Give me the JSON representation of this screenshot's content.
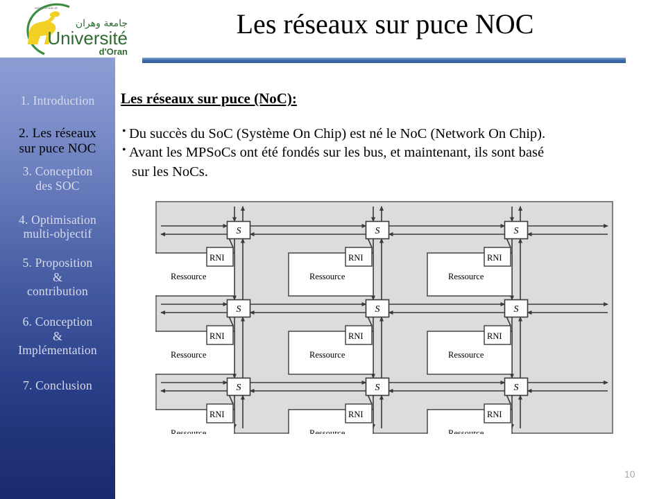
{
  "logo": {
    "icon": "university-oran-logo",
    "url_text": "www.univ-oran.dz",
    "arabic_name": "جامعة وهران",
    "name": "Université",
    "subname": "d'Oran",
    "arc_color": "#3d8c3f",
    "lion_color": "#f2d024",
    "text_color": "#2f6b2f"
  },
  "header": {
    "title": "Les réseaux sur puce NOC",
    "rule_color": "#3e6ca8"
  },
  "sidebar": {
    "active_index": 1,
    "bg_top_color": "#8d9ed4",
    "bg_bottom_color": "#1b2a6e",
    "items": [
      {
        "label": "1. Introduction"
      },
      {
        "label": "2. Les réseaux\nsur puce NOC"
      },
      {
        "label": "3. Conception\ndes SOC"
      },
      {
        "label": "4. Optimisation\nmulti-objectif"
      },
      {
        "label": "5. Proposition\n&\ncontribution"
      },
      {
        "label": "6. Conception\n&\nImplémentation"
      },
      {
        "label": "7. Conclusion"
      }
    ]
  },
  "main": {
    "heading": "Les réseaux sur puce (NoC):",
    "bullets": [
      {
        "marker": "•",
        "text": "Du succès du SoC (Système On Chip) est né le NoC (Network On Chip)."
      },
      {
        "marker": "•",
        "text": "Avant les MPSoCs ont été fondés sur les bus, et maintenant, ils sont basé"
      }
    ],
    "bullet_continuation": "sur les NoCs."
  },
  "diagram": {
    "name": "noc-mesh-topology",
    "panel_color": "#dcdcdc",
    "panel_border_color": "#7f7f7f",
    "rows": 3,
    "cols": 3,
    "switch_label": "S",
    "resource_label": "Ressource",
    "rni_label": "RNI",
    "cells": [
      {
        "row": 0,
        "col": 0,
        "switch": "S",
        "resource": "Ressource",
        "rni": "RNI"
      },
      {
        "row": 0,
        "col": 1,
        "switch": "S",
        "resource": "Ressource",
        "rni": "RNI"
      },
      {
        "row": 0,
        "col": 2,
        "switch": "S",
        "resource": "Ressource",
        "rni": "RNI"
      },
      {
        "row": 1,
        "col": 0,
        "switch": "S",
        "resource": "Ressource",
        "rni": "RNI"
      },
      {
        "row": 1,
        "col": 1,
        "switch": "S",
        "resource": "Ressource",
        "rni": "RNI"
      },
      {
        "row": 1,
        "col": 2,
        "switch": "S",
        "resource": "Ressource",
        "rni": "RNI"
      },
      {
        "row": 2,
        "col": 0,
        "switch": "S",
        "resource": "Ressource",
        "rni": "RNI"
      },
      {
        "row": 2,
        "col": 1,
        "switch": "S",
        "resource": "Ressource",
        "rni": "RNI"
      },
      {
        "row": 2,
        "col": 2,
        "switch": "S",
        "resource": "Ressource",
        "rni": "RNI"
      }
    ]
  },
  "footer": {
    "page_number": "10"
  }
}
